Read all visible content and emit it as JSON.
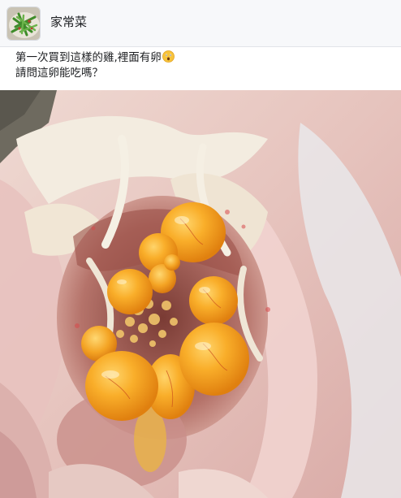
{
  "group": {
    "name": "家常菜",
    "avatar_icon": "green-vegetable-dish-thumbnail"
  },
  "post": {
    "line1": "第一次買到這樣的雞,裡面有卵",
    "line1_emoji": "astonished-face-emoji",
    "line2": "請問這卵能吃嗎？"
  },
  "photo": {
    "subject": "opened-chicken-with-egg-yolks-photo"
  },
  "colors": {
    "header_bg": "#f7f8fa",
    "text": "#1c1e21",
    "yolk": "#f4a21e"
  }
}
